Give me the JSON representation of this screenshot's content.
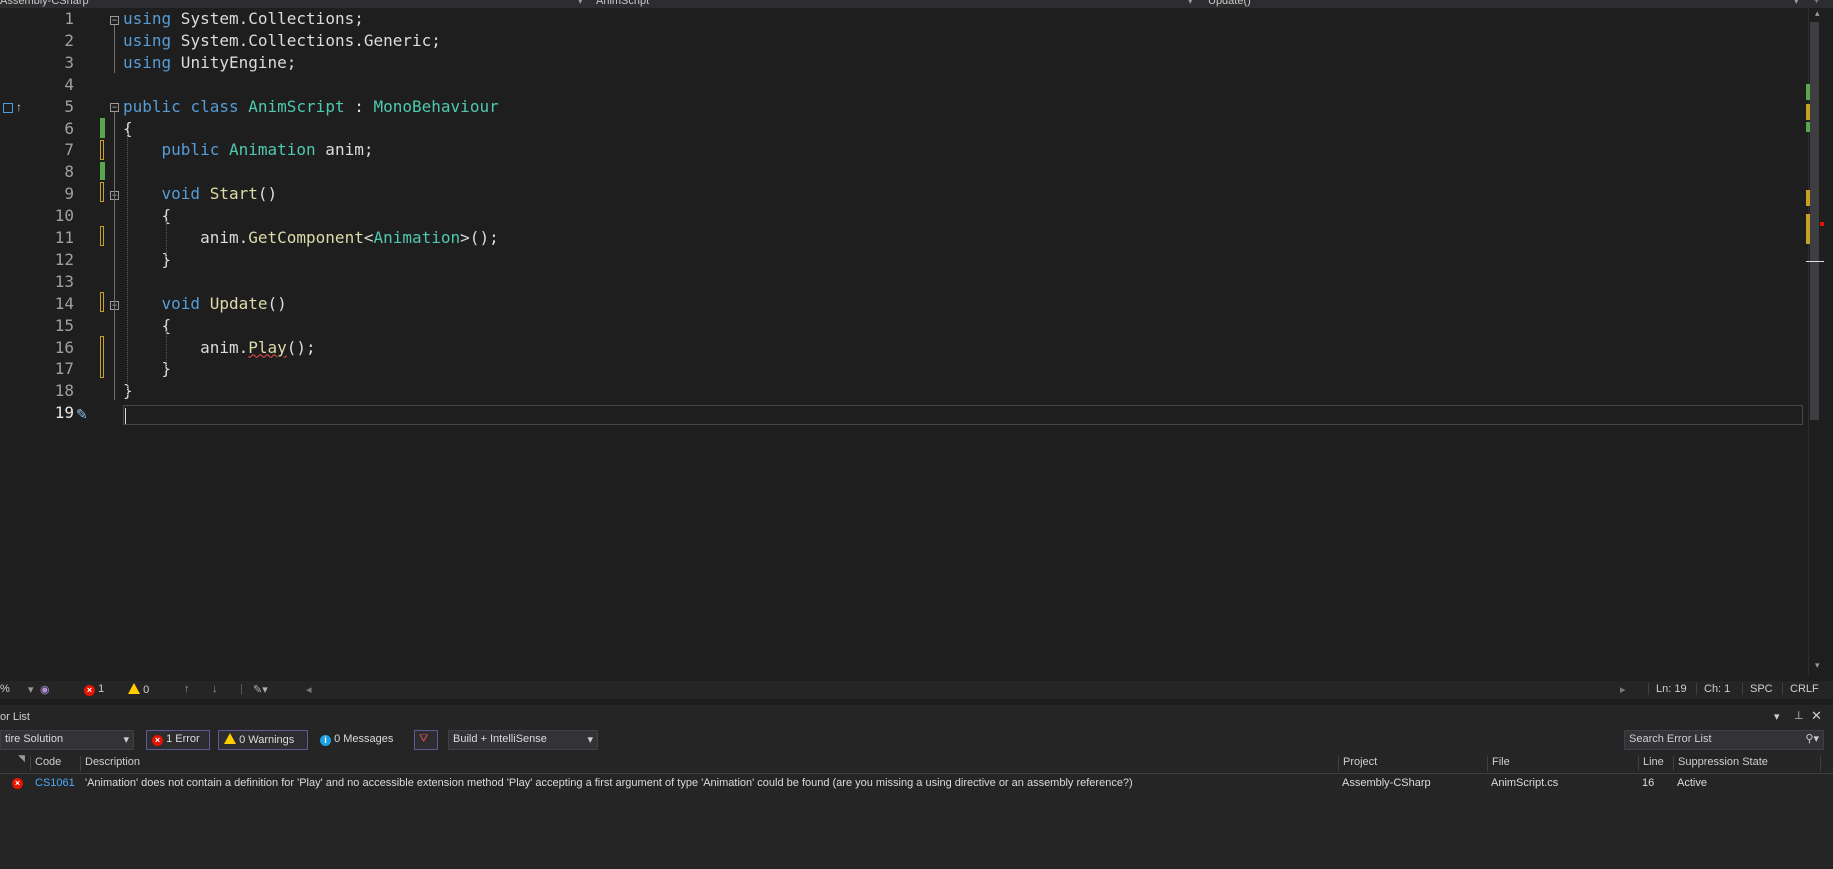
{
  "nav": {
    "project": "Assembly-CSharp",
    "class_dropdown": "AnimScript",
    "member_dropdown": "Update()"
  },
  "editor": {
    "lines": [
      {
        "num": "1",
        "tokens": [
          {
            "t": "using",
            "c": "kw"
          },
          {
            "t": " System"
          },
          {
            "t": ".",
            "c": "dim"
          },
          {
            "t": "Collections;"
          }
        ]
      },
      {
        "num": "2",
        "tokens": [
          {
            "t": "using",
            "c": "kw"
          },
          {
            "t": " System"
          },
          {
            "t": ".",
            "c": "dim"
          },
          {
            "t": "Collections"
          },
          {
            "t": ".",
            "c": "dim"
          },
          {
            "t": "Generic;"
          }
        ]
      },
      {
        "num": "3",
        "tokens": [
          {
            "t": "using",
            "c": "kw"
          },
          {
            "t": " UnityEngine;"
          }
        ]
      },
      {
        "num": "4",
        "tokens": []
      },
      {
        "num": "5",
        "tokens": [
          {
            "t": "public",
            "c": "kw"
          },
          {
            "t": " "
          },
          {
            "t": "class",
            "c": "kw"
          },
          {
            "t": " "
          },
          {
            "t": "AnimScript",
            "c": "ty"
          },
          {
            "t": " : "
          },
          {
            "t": "MonoBehaviour",
            "c": "ty"
          }
        ]
      },
      {
        "num": "6",
        "tokens": [
          {
            "t": "{"
          }
        ]
      },
      {
        "num": "7",
        "tokens": [
          {
            "t": "    "
          },
          {
            "t": "public",
            "c": "kw"
          },
          {
            "t": " "
          },
          {
            "t": "Animation",
            "c": "ty"
          },
          {
            "t": " anim;"
          }
        ]
      },
      {
        "num": "8",
        "tokens": []
      },
      {
        "num": "9",
        "tokens": [
          {
            "t": "    "
          },
          {
            "t": "void",
            "c": "kw"
          },
          {
            "t": " "
          },
          {
            "t": "Start",
            "c": "fn"
          },
          {
            "t": "()"
          }
        ]
      },
      {
        "num": "10",
        "tokens": [
          {
            "t": "    {"
          }
        ]
      },
      {
        "num": "11",
        "tokens": [
          {
            "t": "        anim."
          },
          {
            "t": "GetComponent",
            "c": "fn"
          },
          {
            "t": "<"
          },
          {
            "t": "Animation",
            "c": "ty"
          },
          {
            "t": ">();"
          }
        ]
      },
      {
        "num": "12",
        "tokens": [
          {
            "t": "    }"
          }
        ]
      },
      {
        "num": "13",
        "tokens": []
      },
      {
        "num": "14",
        "tokens": [
          {
            "t": "    "
          },
          {
            "t": "void",
            "c": "kw"
          },
          {
            "t": " "
          },
          {
            "t": "Update",
            "c": "fn"
          },
          {
            "t": "()"
          }
        ]
      },
      {
        "num": "15",
        "tokens": [
          {
            "t": "    {"
          }
        ]
      },
      {
        "num": "16",
        "tokens": [
          {
            "t": "        anim."
          },
          {
            "t": "Play",
            "c": "sq"
          },
          {
            "t": "();"
          }
        ]
      },
      {
        "num": "17",
        "tokens": [
          {
            "t": "    }"
          }
        ]
      },
      {
        "num": "18",
        "tokens": [
          {
            "t": "}"
          }
        ]
      },
      {
        "num": "19",
        "tokens": []
      }
    ],
    "current_line": "19",
    "colors": {
      "keyword": "#569cd6",
      "type": "#4ec9b0",
      "method": "#dcdcaa",
      "error": "#f14c4c"
    }
  },
  "status": {
    "zoom": "%",
    "errors": "1",
    "warnings": "0",
    "ln": "Ln: 19",
    "ch": "Ch: 1",
    "spacing": "SPC",
    "line_ending": "CRLF"
  },
  "error_list": {
    "title": "or List",
    "scope": "tire Solution",
    "errors_btn": "1 Error",
    "warnings_btn": "0 Warnings",
    "messages_btn": "0 Messages",
    "build_filter": "Build + IntelliSense",
    "search_placeholder": "Search Error List",
    "columns": {
      "code": "Code",
      "description": "Description",
      "project": "Project",
      "file": "File",
      "line": "Line",
      "suppression": "Suppression State"
    },
    "rows": [
      {
        "code": "CS1061",
        "description": "'Animation' does not contain a definition for 'Play' and no accessible extension method 'Play' accepting a first argument of type 'Animation' could be found (are you missing a using directive or an assembly reference?)",
        "project": "Assembly-CSharp",
        "file": "AnimScript.cs",
        "line": "16",
        "suppression": "Active"
      }
    ]
  }
}
